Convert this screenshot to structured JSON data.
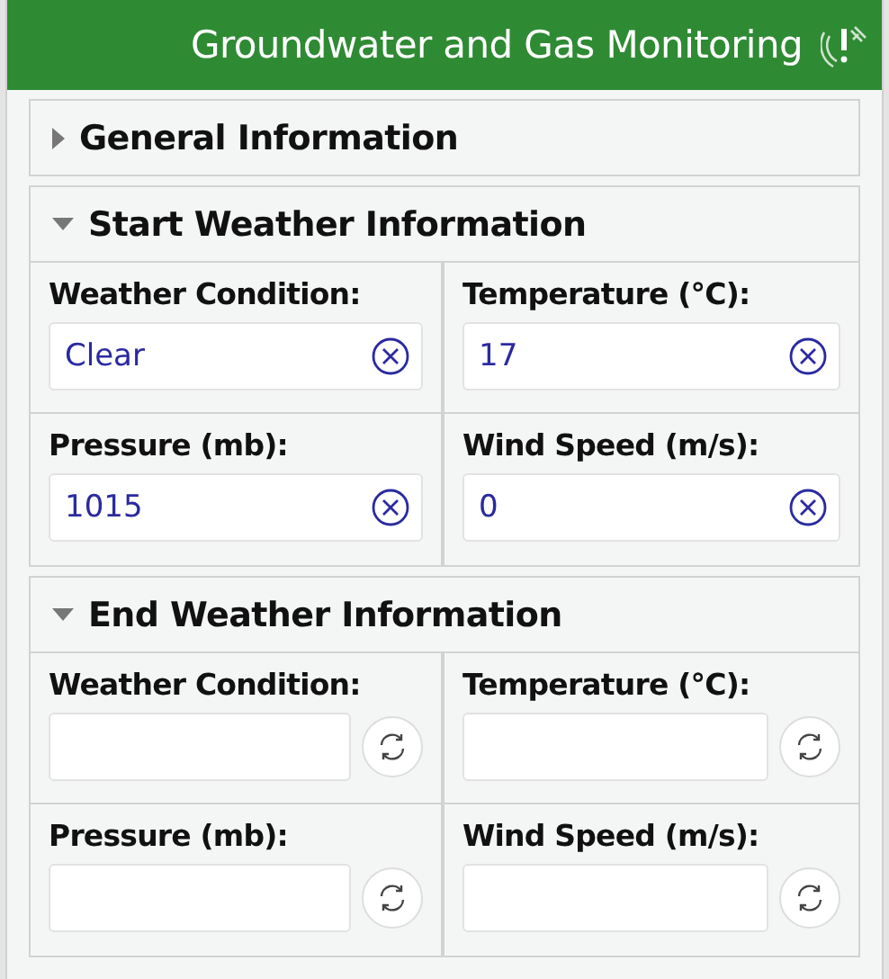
{
  "header": {
    "title": "Groundwater and Gas Monitoring"
  },
  "sections": [
    {
      "title": "General Information",
      "expanded": false
    },
    {
      "title": "Start Weather Information",
      "expanded": true,
      "fields": [
        {
          "label": "Weather Condition:",
          "kind": "clear",
          "value": "Clear"
        },
        {
          "label": "Temperature (°C):",
          "kind": "clear",
          "value": "17"
        },
        {
          "label": "Pressure (mb):",
          "kind": "clear",
          "value": "1015"
        },
        {
          "label": "Wind Speed (m/s):",
          "kind": "clear",
          "value": "0"
        }
      ]
    },
    {
      "title": "End Weather Information",
      "expanded": true,
      "fields": [
        {
          "label": "Weather Condition:",
          "kind": "refresh"
        },
        {
          "label": "Temperature (°C):",
          "kind": "refresh"
        },
        {
          "label": "Pressure (mb):",
          "kind": "refresh"
        },
        {
          "label": "Wind Speed (m/s):",
          "kind": "refresh"
        }
      ]
    }
  ]
}
